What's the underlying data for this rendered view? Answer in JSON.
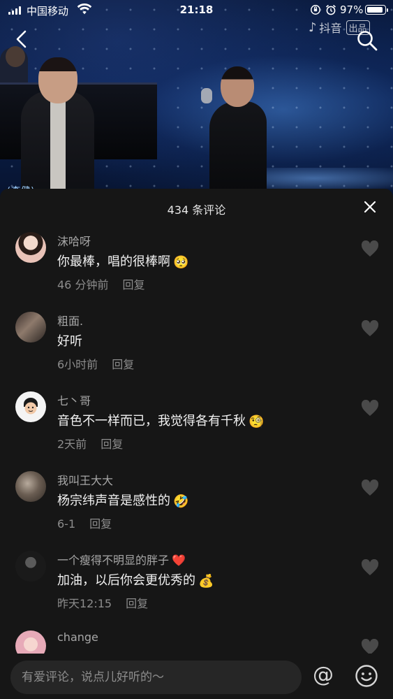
{
  "status_bar": {
    "carrier": "中国移动",
    "time": "21:18",
    "battery": "97%",
    "battery_level": 0.97
  },
  "video": {
    "watermark": "抖音",
    "watermark_badge": "出品",
    "subtitle_fragment": "(李健)"
  },
  "comments_sheet": {
    "title": "434 条评论",
    "comments": [
      {
        "name": "沫哈呀",
        "text": "你最棒，唱的很棒啊",
        "emoji": "🥺",
        "time": "46 分钟前",
        "reply": "回复",
        "avatar_color": "#d8b4a6"
      },
      {
        "name": "粗面.",
        "text": "好听",
        "emoji": "",
        "time": "6小时前",
        "reply": "回复",
        "avatar_color": "#6e5a4e"
      },
      {
        "name": "七丶哥",
        "text": "音色不一样而已，我觉得各有千秋",
        "emoji": "🧐",
        "time": "2天前",
        "reply": "回复",
        "avatar_color": "#f2f2f2"
      },
      {
        "name": "我叫王大大",
        "text": "杨宗纬声音是感性的",
        "emoji": "🤣",
        "time": "6-1",
        "reply": "回复",
        "avatar_color": "#5e5247"
      },
      {
        "name": "一个瘦得不明显的胖子",
        "name_emoji": "❤️",
        "text": "加油，以后你会更优秀的",
        "emoji": "💰",
        "time": "昨天12:15",
        "reply": "回复",
        "avatar_color": "#2d2d2d"
      },
      {
        "name": "change",
        "text": "",
        "emoji": "",
        "time": "",
        "reply": "",
        "avatar_color": "#f0c4cd"
      }
    ]
  },
  "input_bar": {
    "placeholder": "有爱评论，说点儿好听的～",
    "at_symbol": "@"
  }
}
